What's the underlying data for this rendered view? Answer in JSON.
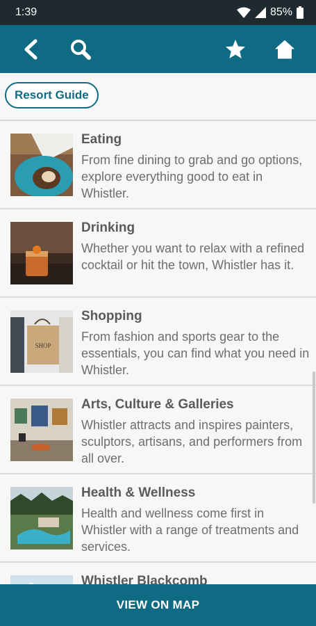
{
  "status": {
    "time": "1:39",
    "battery": "85%"
  },
  "toolbar": {
    "back_icon": "chevron-left-icon",
    "search_icon": "search-icon",
    "favorite_icon": "star-icon",
    "home_icon": "home-icon"
  },
  "chip": {
    "label": "Resort Guide"
  },
  "items": [
    {
      "title": "Eating",
      "description": "From fine  dining to grab and go options, explore everything good to eat in Whistler."
    },
    {
      "title": "Drinking",
      "description": "Whether you want to relax with a refined cocktail or hit the town, Whistler has it."
    },
    {
      "title": "Shopping",
      "description": "From fashion and sports gear to the essentials, you can find what you need in Whistler.",
      "bag_text": "SHOP"
    },
    {
      "title": "Arts, Culture & Galleries",
      "description": "Whistler attracts and inspires painters, sculptors, artisans, and performers from all over."
    },
    {
      "title": "Health & Wellness",
      "description": "Health and wellness come first in Whistler with a range of treatments and services."
    },
    {
      "title": "Whistler Blackcomb",
      "description": ""
    }
  ],
  "bottom": {
    "label": "VIEW ON MAP"
  },
  "colors": {
    "primary": "#0f6b84",
    "status_bar": "#1f2a30"
  }
}
